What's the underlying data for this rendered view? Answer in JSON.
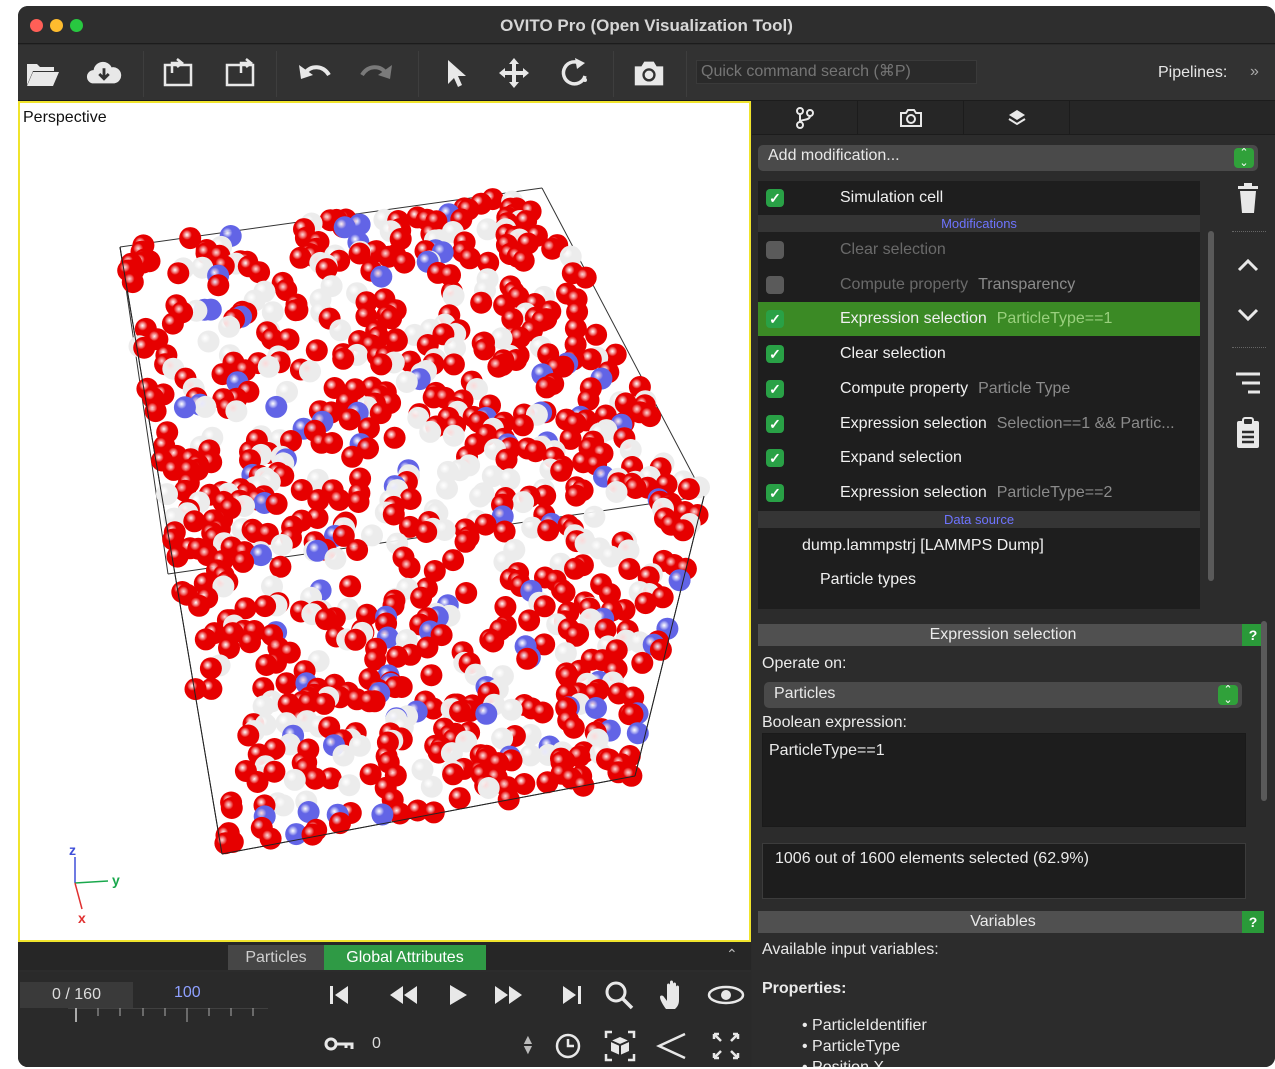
{
  "window": {
    "title": "OVITO Pro (Open Visualization Tool)"
  },
  "toolbar": {
    "search_placeholder": "Quick command search (⌘P)",
    "pipelines_label": "Pipelines:",
    "icons": [
      "open-folder-icon",
      "download-icon",
      "export-icon",
      "export-alt-icon",
      "undo-icon",
      "redo-icon",
      "select-arrow-icon",
      "move-icon",
      "rotate-icon",
      "camera-icon",
      "chevron-double-right-icon"
    ]
  },
  "viewport": {
    "caption": "Perspective",
    "axes": {
      "z": "z",
      "y": "y",
      "x": "x"
    },
    "particle_colors": {
      "type1": "#e60000",
      "type2": "#ececec",
      "type3": "#6264e6"
    }
  },
  "command_panel": {
    "tabs": [
      "Particles",
      "Global Attributes"
    ],
    "active_tab": "Global Attributes"
  },
  "animation": {
    "frame_display": "0 / 160",
    "ruler_label": "100",
    "key_field": "0"
  },
  "right_panel": {
    "tab_icons": [
      "pipeline-icon",
      "render-camera-icon",
      "layers-icon"
    ],
    "add_modification": "Add modification...",
    "pipeline": {
      "sim_cell": "Simulation cell",
      "modifications_header": "Modifications",
      "data_source_header": "Data source",
      "modifiers": [
        {
          "name": "Clear selection",
          "param": "",
          "enabled": false
        },
        {
          "name": "Compute property",
          "param": "Transparency",
          "enabled": false
        },
        {
          "name": "Expression selection",
          "param": "ParticleType==1",
          "enabled": true,
          "selected": true
        },
        {
          "name": "Clear selection",
          "param": "",
          "enabled": true
        },
        {
          "name": "Compute property",
          "param": "Particle Type",
          "enabled": true
        },
        {
          "name": "Expression selection",
          "param": "Selection==1 && Partic...",
          "enabled": true
        },
        {
          "name": "Expand selection",
          "param": "",
          "enabled": true
        },
        {
          "name": "Expression selection",
          "param": "ParticleType==2",
          "enabled": true
        }
      ],
      "source_file": "dump.lammpstrj [LAMMPS Dump]",
      "particle_types": "Particle types"
    },
    "expr_panel": {
      "header": "Expression selection",
      "help": "?",
      "operate_on_label": "Operate on:",
      "operate_on_value": "Particles",
      "bool_label": "Boolean expression:",
      "expression": "ParticleType==1",
      "status": "1006 out of 1600 elements selected (62.9%)"
    },
    "variables_panel": {
      "header": "Variables",
      "help": "?",
      "available_label": "Available input variables:",
      "properties_label": "Properties:",
      "items": [
        "• ParticleIdentifier",
        "• ParticleType",
        "• Position.X"
      ]
    }
  },
  "colors": {
    "accent_green": "#3b8a25",
    "check_green": "#29a146",
    "section_blue": "#6e74ff",
    "viewport_border": "#f0e42c"
  }
}
